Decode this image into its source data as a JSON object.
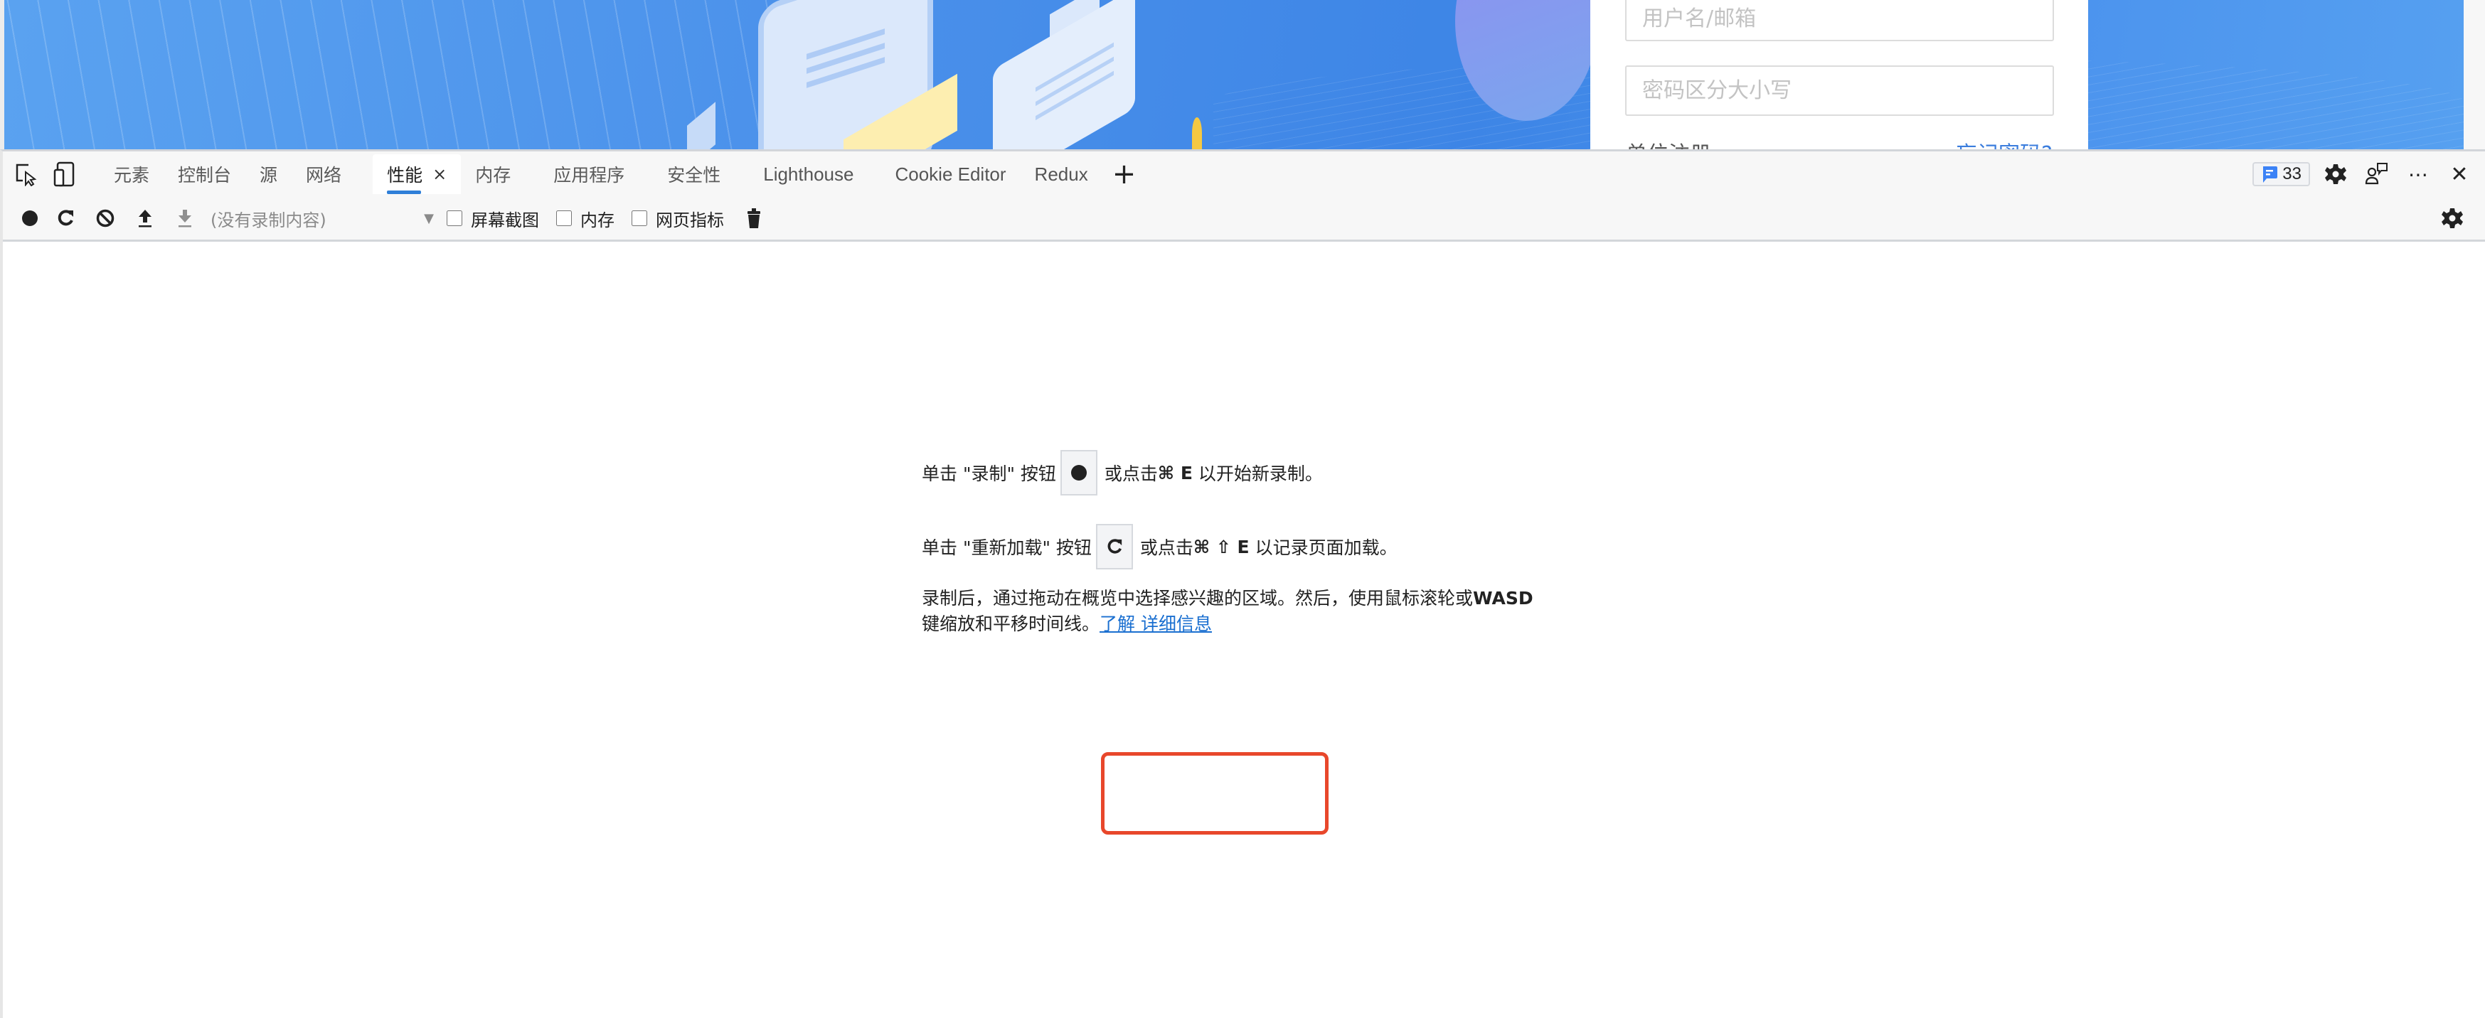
{
  "page": {
    "login": {
      "username_placeholder": "用户名/邮箱",
      "password_placeholder": "密码区分大小写",
      "register_link": "单位注册",
      "forgot_link": "忘记密码?"
    }
  },
  "devtools": {
    "tabs": [
      {
        "label": "元素",
        "active": false
      },
      {
        "label": "控制台",
        "active": false
      },
      {
        "label": "源",
        "active": false
      },
      {
        "label": "网络",
        "active": false
      },
      {
        "label": "性能",
        "active": true,
        "closable": true
      },
      {
        "label": "内存",
        "active": false
      },
      {
        "label": "应用程序",
        "active": false
      },
      {
        "label": "安全性",
        "active": false
      },
      {
        "label": "Lighthouse",
        "active": false
      },
      {
        "label": "Cookie Editor",
        "active": false
      },
      {
        "label": "Redux",
        "active": false
      }
    ],
    "close_tab_glyph": "×",
    "add_tab_glyph": "+",
    "issues_count": "33",
    "more_glyph": "⋯",
    "close_glyph": "✕",
    "toolbar": {
      "recording_select": "(没有录制内容)",
      "checkboxes": [
        {
          "label": "屏幕截图",
          "checked": false
        },
        {
          "label": "内存",
          "checked": false
        },
        {
          "label": "网页指标",
          "checked": false
        }
      ]
    },
    "landing": {
      "record_prefix": "单击 \"录制\" 按钮",
      "record_suffix_pre": "或点击",
      "record_shortcut": "⌘ E",
      "record_suffix_post": "以开始新录制。",
      "reload_prefix": "单击 \"重新加载\" 按钮",
      "reload_suffix_pre": "或点击",
      "reload_shortcut": "⌘ ⇧ E",
      "reload_suffix_post": "以记录页面加载。",
      "para_text": "录制后，通过拖动在概览中选择感兴趣的区域。然后，使用鼠标滚轮或",
      "para_bold": "WASD",
      "para_text2": "键缩放和平移时间线。",
      "learn_more_link": "了解  详细信息"
    }
  },
  "colors": {
    "accent": "#2f7fd8",
    "link": "#1a6fd0",
    "highlight_box": "#e8472b",
    "issues_icon": "#3b82f6"
  }
}
